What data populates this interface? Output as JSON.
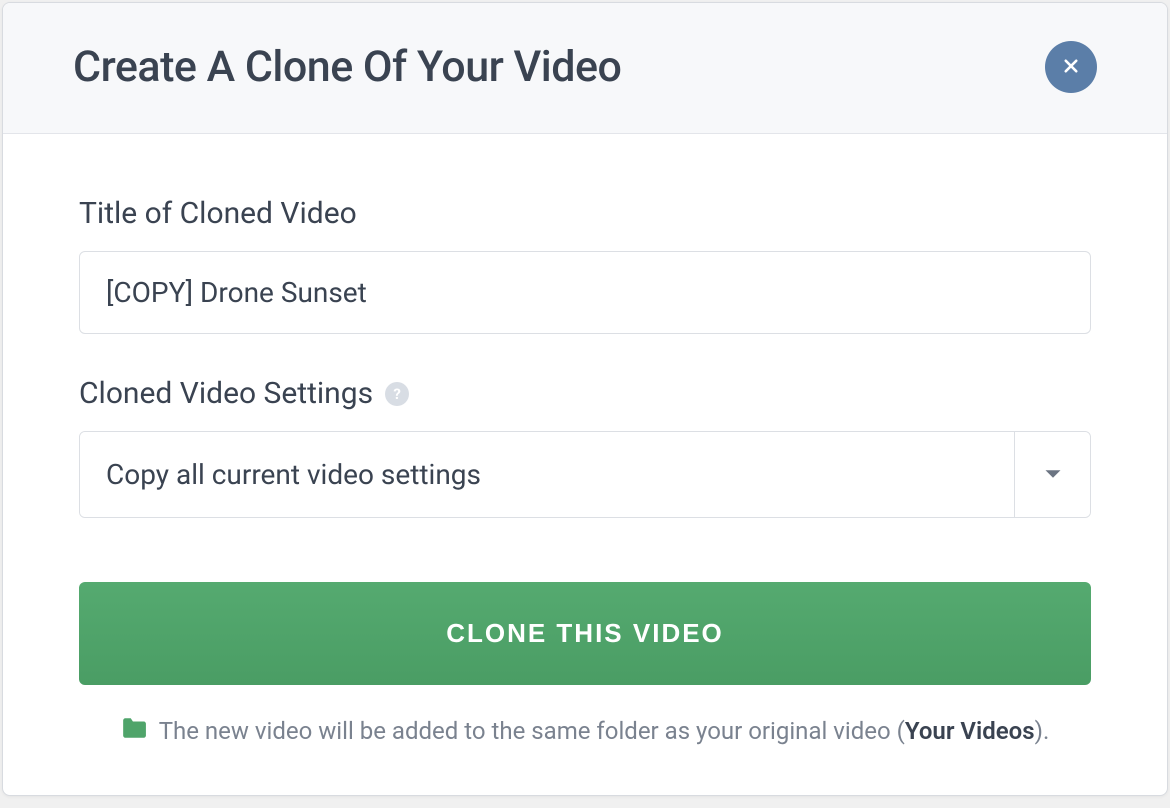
{
  "modal": {
    "title": "Create A Clone Of Your Video",
    "close_label": "Close"
  },
  "fields": {
    "title": {
      "label": "Title of Cloned Video",
      "value": "[COPY] Drone Sunset"
    },
    "settings": {
      "label": "Cloned Video Settings",
      "selected": "Copy all current video settings"
    }
  },
  "actions": {
    "submit": "CLONE THIS VIDEO"
  },
  "hint": {
    "prefix": "The new video will be added to the same folder as your original video (",
    "folder_name": "Your Videos",
    "suffix": ")."
  }
}
